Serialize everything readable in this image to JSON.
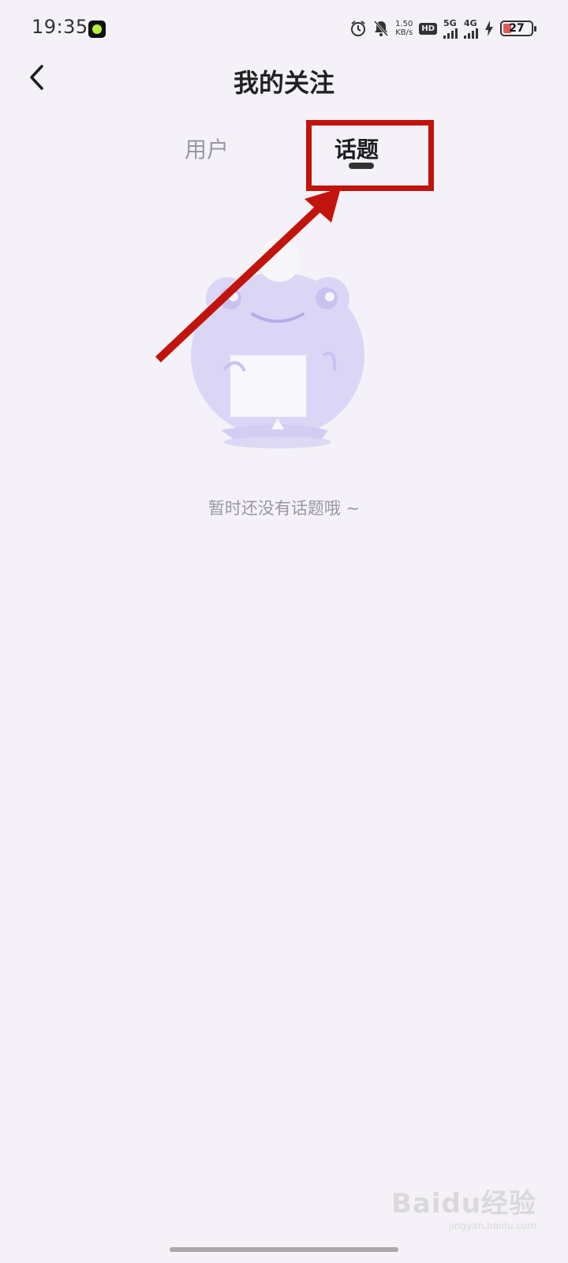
{
  "status_bar": {
    "time": "19:35",
    "speed_value": "1.50",
    "speed_unit": "KB/s",
    "hd_label": "HD",
    "network_5g": "5G",
    "network_4g": "4G",
    "battery_level": "27",
    "icons": [
      "app-icon",
      "alarm-icon",
      "mute-icon",
      "signal-icon",
      "charging-icon",
      "battery-icon"
    ]
  },
  "header": {
    "title": "我的关注",
    "back_icon": "chevron-left-icon"
  },
  "tabs": [
    {
      "label": "用户",
      "selected": false
    },
    {
      "label": "话题",
      "selected": true
    }
  ],
  "empty_state": {
    "illustration": "frog-holding-paper",
    "message": "暂时还没有话题哦 ~"
  },
  "watermark": {
    "logo": "Baidu经验",
    "url": "jingyan.baidu.com"
  },
  "colors": {
    "background": "#f4f1f8",
    "annotation": "#c1140c",
    "illustration": "#d6d0f2",
    "muted_text": "#9a97a0"
  }
}
